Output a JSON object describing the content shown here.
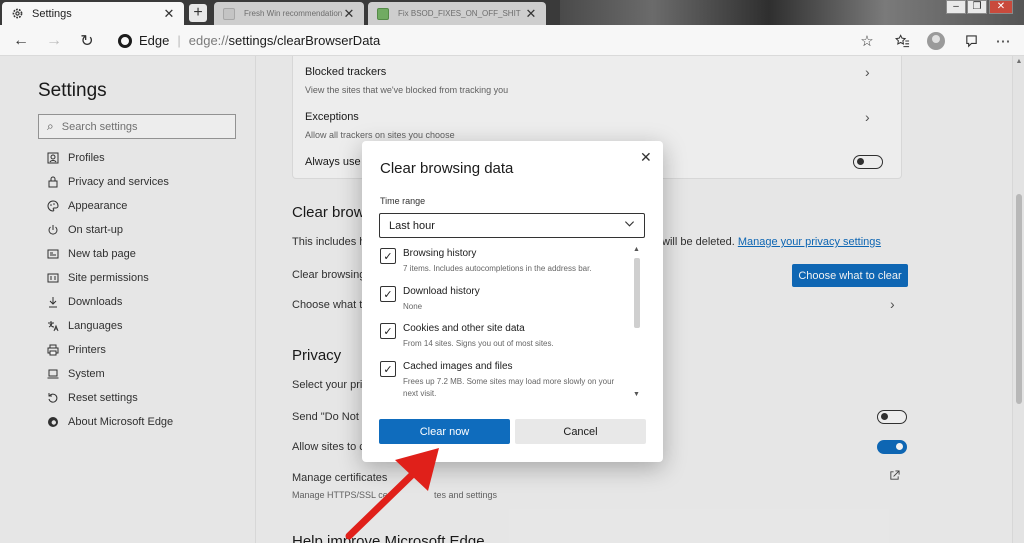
{
  "tabs": [
    {
      "title": "Settings",
      "active": true
    },
    {
      "title": "Fresh Win recommendations Timelin",
      "active": false
    },
    {
      "title": "Fix BSOD_FIXES_ON_OFF_SHIT",
      "active": false
    }
  ],
  "window_controls": [
    "–",
    "❐",
    "✕"
  ],
  "address": {
    "label": "Edge",
    "host": "edge://",
    "path": "settings/clearBrowserData"
  },
  "sidebar": {
    "title": "Settings",
    "search_placeholder": "Search settings",
    "items": [
      {
        "label": "Profiles",
        "icon": "profile-icon"
      },
      {
        "label": "Privacy and services",
        "icon": "lock-icon"
      },
      {
        "label": "Appearance",
        "icon": "palette-icon"
      },
      {
        "label": "On start-up",
        "icon": "power-icon"
      },
      {
        "label": "New tab page",
        "icon": "newtab-icon"
      },
      {
        "label": "Site permissions",
        "icon": "permissions-icon"
      },
      {
        "label": "Downloads",
        "icon": "download-icon"
      },
      {
        "label": "Languages",
        "icon": "language-icon"
      },
      {
        "label": "Printers",
        "icon": "printer-icon"
      },
      {
        "label": "System",
        "icon": "laptop-icon"
      },
      {
        "label": "Reset settings",
        "icon": "reset-icon"
      },
      {
        "label": "About Microsoft Edge",
        "icon": "edge-icon"
      }
    ]
  },
  "main": {
    "blocked_trackers": {
      "title": "Blocked trackers",
      "sub": "View the sites that we've blocked from tracking you"
    },
    "exceptions": {
      "title": "Exceptions",
      "sub": "Allow all trackers on sites you choose"
    },
    "always_use": "Always use \"",
    "clear_heading": "Clear brow",
    "clear_text": "This includes h",
    "clear_text_tail": "will be deleted.",
    "manage_privacy_link": "Manage your privacy settings",
    "clear_now_row": "Clear browsing",
    "choose_button": "Choose what to clear",
    "choose_row": "Choose what to",
    "privacy_heading": "Privacy",
    "privacy_text": "Select your priv",
    "send_dnt": "Send \"Do Not",
    "allow_sites": "Allow sites to c",
    "manage_certs": {
      "title": "Manage certificates",
      "sub": "Manage HTTPS/SSL ce",
      "sub_tail": "tes and settings"
    },
    "help_heading": "Help improve Microsoft Edge"
  },
  "dialog": {
    "title": "Clear browsing data",
    "time_range_label": "Time range",
    "time_range_value": "Last hour",
    "options": [
      {
        "title": "Browsing history",
        "sub": "7 items. Includes autocompletions in the address bar.",
        "checked": true
      },
      {
        "title": "Download history",
        "sub": "None",
        "checked": true
      },
      {
        "title": "Cookies and other site data",
        "sub": "From 14 sites. Signs you out of most sites.",
        "checked": true
      },
      {
        "title": "Cached images and files",
        "sub": "Frees up 7.2 MB. Some sites may load more slowly on your next visit.",
        "checked": true
      }
    ],
    "clear_button": "Clear now",
    "cancel_button": "Cancel"
  },
  "colors": {
    "accent": "#0f6cbd",
    "annotation": "#e0201a"
  }
}
